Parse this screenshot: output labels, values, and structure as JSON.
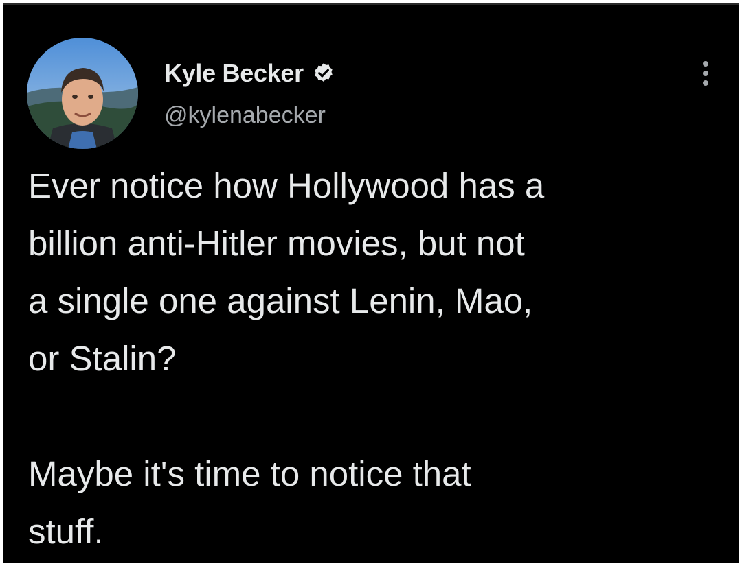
{
  "author": {
    "display_name": "Kyle Becker",
    "handle": "@kylenabecker",
    "verified": true,
    "avatar_icon": "profile-photo"
  },
  "menu": {
    "icon": "more-options-icon"
  },
  "tweet": {
    "text": "Ever notice how Hollywood has a\nbillion anti-Hitler movies, but not\na single one against Lenin, Mao,\nor Stalin?\n\nMaybe it's time to notice that\nstuff."
  },
  "colors": {
    "background": "#000000",
    "text": "#e7e9ea",
    "secondary_text": "#a5a9ad",
    "verified_badge": "#e7e9ea"
  }
}
